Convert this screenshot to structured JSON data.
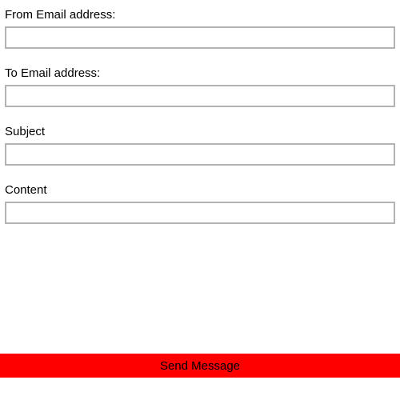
{
  "form": {
    "from": {
      "label": "From Email address:",
      "value": ""
    },
    "to": {
      "label": "To Email address:",
      "value": ""
    },
    "subject": {
      "label": "Subject",
      "value": ""
    },
    "content": {
      "label": "Content",
      "value": ""
    }
  },
  "actions": {
    "send_label": "Send Message"
  }
}
